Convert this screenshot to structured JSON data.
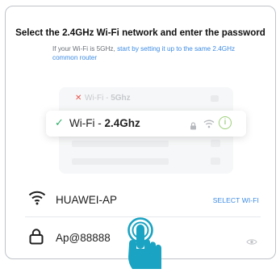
{
  "title": "Select the 2.4GHz Wi-Fi network and enter the password",
  "hint": {
    "prefix": "If your Wi-Fi is 5GHz, ",
    "accent": "start by setting it up to the same 2.4GHz common router"
  },
  "networks": {
    "unavailable": {
      "prefix": "Wi-Fi - ",
      "band": "5Ghz",
      "status_icon": "x-icon"
    },
    "selected": {
      "prefix": "Wi-Fi - ",
      "band": "2.4Ghz",
      "status_icon": "check-icon"
    }
  },
  "wifi_row": {
    "ssid": "HUAWEI-AP",
    "action_label": "SELECT WI-FI"
  },
  "password_row": {
    "value": "Ap@88888"
  },
  "colors": {
    "accent_blue": "#3c8be4",
    "check_green": "#2dae6a",
    "error_red": "#e8534a",
    "hand_teal": "#1aa3c2"
  }
}
